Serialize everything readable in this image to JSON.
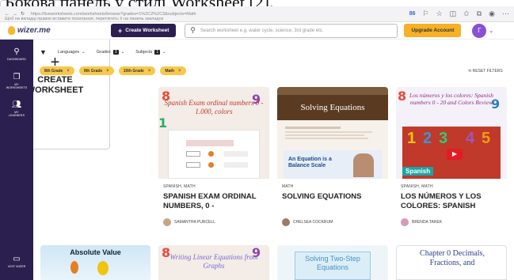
{
  "caption": "Бокова панель у стилі Worksheet [2].",
  "browser": {
    "url": "https://liveworksheets.com/worksheets/browse?grades=1%2C2%2C3&subjects=Math",
    "url_hint": "Щоб на вкладці правок вставити посилання, перетягніть її на панель закладок",
    "ext_badge": "86"
  },
  "header": {
    "logo": "wizer.me",
    "create_label": "Create Worksheet",
    "search_placeholder": "Search worksheet e.g. water cycle, science, 3rd grade etc.",
    "upgrade_label": "Upgrade Account",
    "avatar_letter": "Г"
  },
  "sidebar": {
    "items": [
      {
        "label": "DASHBOARD",
        "icon": "search-icon"
      },
      {
        "label": "MY WORKSHEETS",
        "icon": "copy-icon"
      },
      {
        "label": "MY LEARNERS",
        "icon": "people-icon"
      },
      {
        "label": "VISIT WIZER",
        "icon": "monitor-icon"
      }
    ]
  },
  "filters": {
    "languages": "Languages",
    "grades": "Grades",
    "grades_count": "3",
    "subjects": "Subjects",
    "subjects_count": "1",
    "reset": "RESET FILTERS",
    "chips": [
      "8th Grade",
      "9th Grade",
      "10th Grade",
      "Math"
    ]
  },
  "create_card": {
    "plus": "+",
    "label": "CREATE WORKSHEET"
  },
  "cards": [
    {
      "thumb_title": "Spanish Exam ordinal numbers 0 - 1.000, colors",
      "sub": "SPANISH, MATH",
      "title": "SPANISH EXAM ORDINAL NUMBERS, 0 -",
      "author": "SAMANTHA PURCELL"
    },
    {
      "thumb_title": "Solving Equations",
      "thumb_caption": "An Equation is a Balance Scale",
      "sub": "MATH",
      "title": "SOLVING EQUATIONS",
      "author": "CHELSEA COCKRUM"
    },
    {
      "thumb_title": "Los números y los colores: Spanish numbers 0 - 20 and Colors Review",
      "thumb_badge": "Spanish",
      "sub": "SPANISH, MATH",
      "title": "LOS NÚMEROS Y LOS COLORES: SPANISH",
      "author": "BRENDA TAREK"
    }
  ],
  "bottom_cards": [
    {
      "title": "Absolute Value"
    },
    {
      "title": "Writing Linear Equations from Graphs"
    },
    {
      "title": "Solving Two-Step Equations"
    },
    {
      "title": "Chapter 0 Decimals, Fractions, and"
    }
  ],
  "colors": {
    "sidebar": "#2b1f4f",
    "accent": "#f6b127",
    "chip": "#f7c84b",
    "avatar": "#8a4fd6"
  }
}
